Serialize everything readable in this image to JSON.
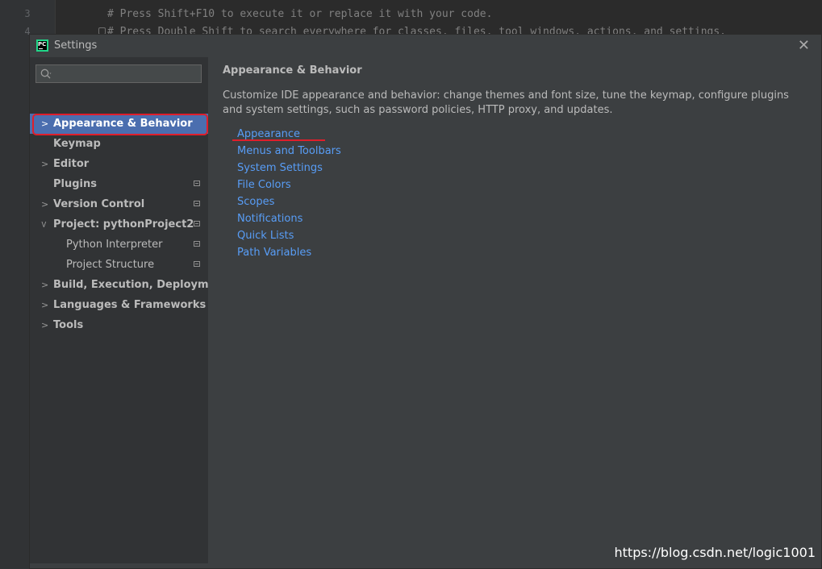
{
  "editor": {
    "line_numbers": [
      "3",
      "4"
    ],
    "lines": [
      "# Press Shift+F10 to execute it or replace it with your code.",
      "# Press Double Shift to search everywhere for classes, files, tool windows, actions, and settings."
    ]
  },
  "dialog": {
    "title": "Settings",
    "app_icon_text": "PC",
    "close_icon": "close-icon"
  },
  "sidebar": {
    "search": {
      "value": "",
      "placeholder": "",
      "icon": "search-icon"
    },
    "items": [
      {
        "label": "Appearance & Behavior",
        "expandable": true,
        "selected": true,
        "bold": true,
        "project_icon": false
      },
      {
        "label": "Keymap",
        "expandable": false,
        "selected": false,
        "bold": true,
        "project_icon": false
      },
      {
        "label": "Editor",
        "expandable": true,
        "selected": false,
        "bold": true,
        "project_icon": false
      },
      {
        "label": "Plugins",
        "expandable": false,
        "selected": false,
        "bold": true,
        "project_icon": true
      },
      {
        "label": "Version Control",
        "expandable": true,
        "selected": false,
        "bold": true,
        "project_icon": true
      },
      {
        "label": "Project: pythonProject2",
        "expandable": true,
        "expanded": true,
        "selected": false,
        "bold": true,
        "project_icon": true
      },
      {
        "label": "Python Interpreter",
        "expandable": false,
        "selected": false,
        "bold": false,
        "child": true,
        "project_icon": true
      },
      {
        "label": "Project Structure",
        "expandable": false,
        "selected": false,
        "bold": false,
        "child": true,
        "project_icon": true
      },
      {
        "label": "Build, Execution, Deployment",
        "expandable": true,
        "selected": false,
        "bold": true,
        "project_icon": false
      },
      {
        "label": "Languages & Frameworks",
        "expandable": true,
        "selected": false,
        "bold": true,
        "project_icon": false
      },
      {
        "label": "Tools",
        "expandable": true,
        "selected": false,
        "bold": true,
        "project_icon": false
      }
    ]
  },
  "content": {
    "heading": "Appearance & Behavior",
    "description": "Customize IDE appearance and behavior: change themes and font size, tune the keymap, configure plugins and system settings, such as password policies, HTTP proxy, and updates.",
    "links": [
      "Appearance",
      "Menus and Toolbars",
      "System Settings",
      "File Colors",
      "Scopes",
      "Notifications",
      "Quick Lists",
      "Path Variables"
    ]
  },
  "watermark": "https://blog.csdn.net/logic1001",
  "colors": {
    "selection": "#4b6eaf",
    "link": "#589df6",
    "annotation_red": "#e01e2b"
  }
}
